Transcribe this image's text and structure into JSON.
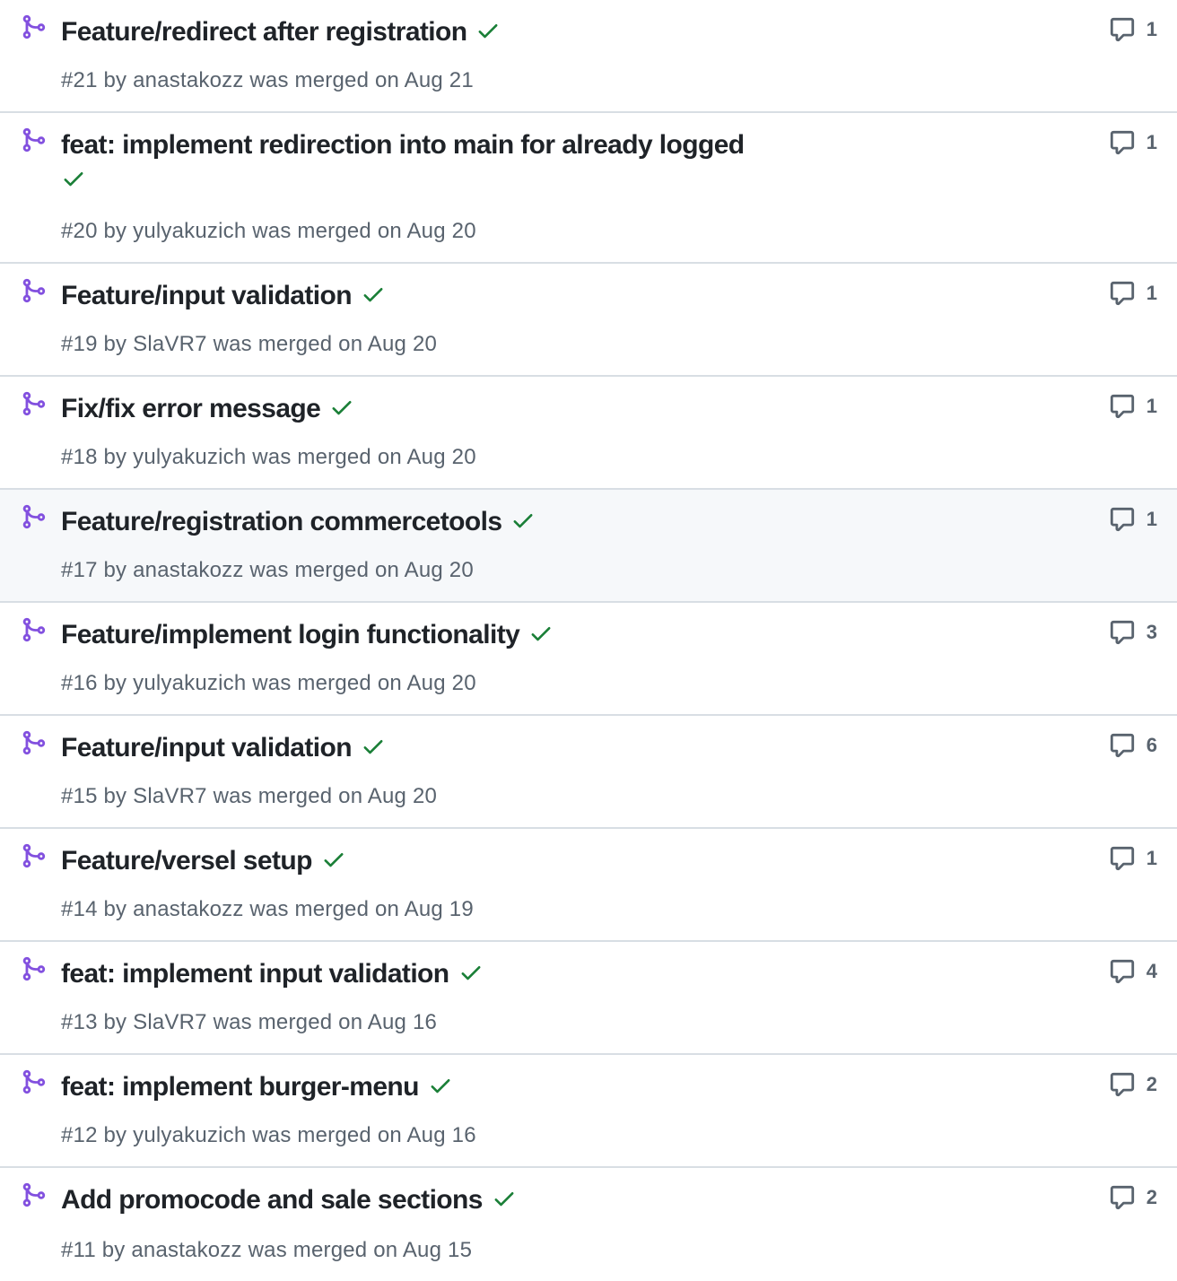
{
  "colors": {
    "merged_icon": "#8250df",
    "check": "#1a7f37",
    "meta_text": "#59636e",
    "title_text": "#1f2328",
    "divider": "#d8dee4",
    "hover_bg": "#f6f8fa"
  },
  "icons": {
    "status": "git-merge-icon",
    "check": "check-icon",
    "comment": "comment-icon"
  },
  "pull_requests": [
    {
      "title": "Feature/redirect after registration",
      "meta": "#21 by anastakozz was merged on Aug 21",
      "comments": "1"
    },
    {
      "title": "feat: implement redirection into main for already logged",
      "meta": "#20 by yulyakuzich was merged on Aug 20",
      "comments": "1"
    },
    {
      "title": "Feature/input validation",
      "meta": "#19 by SlaVR7 was merged on Aug 20",
      "comments": "1"
    },
    {
      "title": "Fix/fix error message",
      "meta": "#18 by yulyakuzich was merged on Aug 20",
      "comments": "1"
    },
    {
      "title": "Feature/registration commercetools",
      "meta": "#17 by anastakozz was merged on Aug 20",
      "comments": "1"
    },
    {
      "title": "Feature/implement login functionality",
      "meta": "#16 by yulyakuzich was merged on Aug 20",
      "comments": "3"
    },
    {
      "title": "Feature/input validation",
      "meta": "#15 by SlaVR7 was merged on Aug 20",
      "comments": "6"
    },
    {
      "title": "Feature/versel setup",
      "meta": "#14 by anastakozz was merged on Aug 19",
      "comments": "1"
    },
    {
      "title": "feat: implement input validation",
      "meta": "#13 by SlaVR7 was merged on Aug 16",
      "comments": "4"
    },
    {
      "title": "feat: implement burger-menu",
      "meta": "#12 by yulyakuzich was merged on Aug 16",
      "comments": "2"
    },
    {
      "title": "Add promocode and sale sections",
      "meta": "#11 by anastakozz was merged on Aug 15",
      "comments": "2"
    }
  ]
}
